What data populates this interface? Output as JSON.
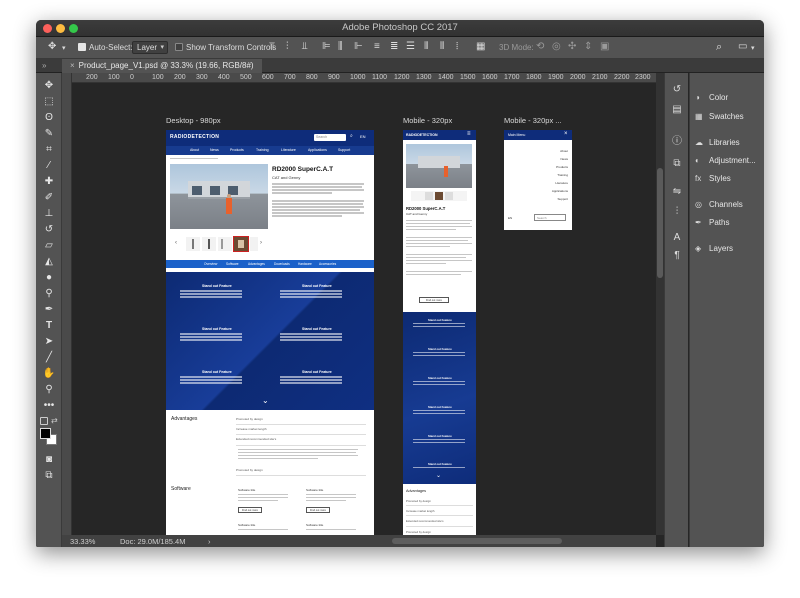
{
  "window": {
    "title": "Adobe Photoshop CC 2017"
  },
  "options_bar": {
    "auto_select_label": "Auto-Select:",
    "auto_select_value": "Layer",
    "show_transform_label": "Show Transform Controls",
    "mode_3d": "3D Mode:"
  },
  "document_tab": {
    "label": "Product_page_V1.psd @ 33.3% (19.66, RGB/8#)"
  },
  "ruler": {
    "ticks": [
      "200",
      "100",
      "0",
      "100",
      "200",
      "300",
      "400",
      "500",
      "600",
      "700",
      "800",
      "900",
      "1000",
      "1100",
      "1200",
      "1300",
      "1400",
      "1500",
      "1600",
      "1700",
      "1800",
      "1900",
      "2000",
      "2100",
      "2200",
      "2300",
      "2400"
    ]
  },
  "status_bar": {
    "zoom": "33.33%",
    "doc_size": "Doc: 29.0M/185.4M"
  },
  "panels": {
    "items": [
      {
        "label": "Color",
        "icon": "color-wheel-icon"
      },
      {
        "label": "Swatches",
        "icon": "swatches-grid-icon"
      },
      {
        "label": "Libraries",
        "icon": "libraries-icon"
      },
      {
        "label": "Adjustment...",
        "icon": "adjustments-icon"
      },
      {
        "label": "Styles",
        "icon": "styles-icon"
      },
      {
        "label": "Channels",
        "icon": "channels-icon"
      },
      {
        "label": "Paths",
        "icon": "paths-icon"
      },
      {
        "label": "Layers",
        "icon": "layers-icon"
      }
    ]
  },
  "artboards": {
    "desktop": {
      "label": "Desktop - 980px"
    },
    "mobile1": {
      "label": "Mobile - 320px"
    },
    "mobile2": {
      "label": "Mobile - 320px ..."
    }
  },
  "site": {
    "brand": "RADIODETECTION",
    "search_placeholder": "Search",
    "lang": "EN",
    "nav": [
      "About",
      "News",
      "Products",
      "Training",
      "Literature",
      "Applications",
      "Support"
    ],
    "product_title": "RD2000 SuperC.A.T",
    "product_subtitle": "CAT and Genny",
    "section_tabs": [
      "Overview",
      "Software",
      "Advantages",
      "Downloads",
      "Hardware",
      "Accessories"
    ],
    "feature_heading": "Stand out Feature",
    "advantages_heading": "Advantages",
    "advantages_items": [
      "Promoted by design",
      "Increase market length",
      "Extended recommended site's",
      "Promoted by design"
    ],
    "software_heading": "Software",
    "software_items": [
      "Software title",
      "Software title",
      "Software title",
      "Software title"
    ],
    "software_button": "Find out more",
    "menu_title": "Main Menu",
    "menu_items": [
      "About",
      "News",
      "Products",
      "Training",
      "Literature",
      "Applications",
      "Support"
    ]
  },
  "colors": {
    "accent_navy": "#0e2c7a",
    "bar_blue": "#1b61c9",
    "ps_dark": "#262626",
    "ps_panel": "#535353"
  }
}
